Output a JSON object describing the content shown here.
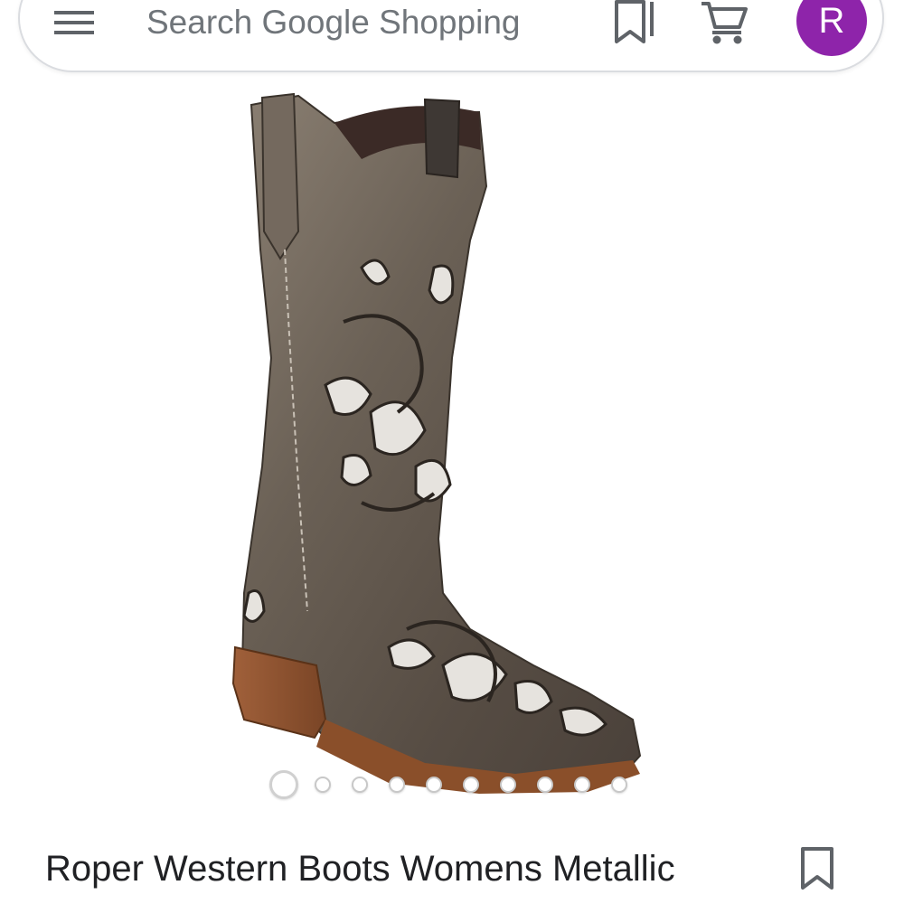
{
  "header": {
    "search_placeholder": "Search Google Shopping",
    "avatar_letter": "R",
    "avatar_color": "#8e24aa",
    "icons": [
      "menu-icon",
      "bookmark-icon",
      "shopping-cart-icon"
    ]
  },
  "product": {
    "title": "Roper Western Boots Womens Metallic",
    "image_count": 10,
    "active_image_index": 0
  }
}
